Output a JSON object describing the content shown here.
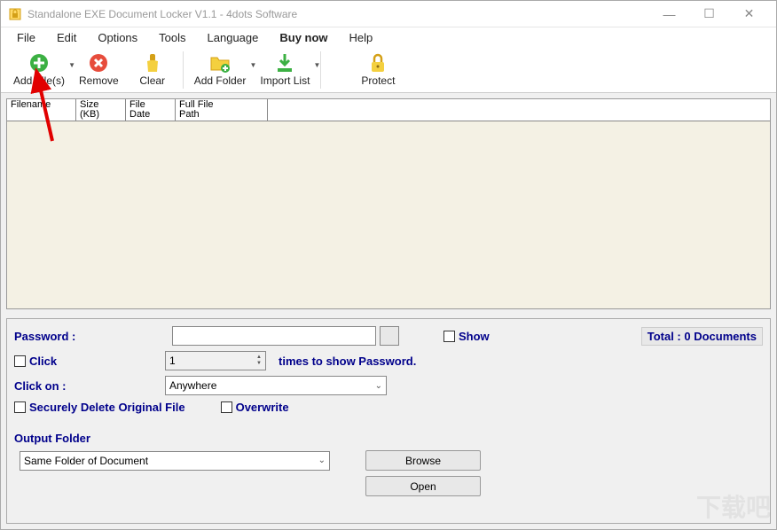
{
  "window": {
    "title": "Standalone EXE Document Locker V1.1 - 4dots Software"
  },
  "menu": {
    "file": "File",
    "edit": "Edit",
    "options": "Options",
    "tools": "Tools",
    "language": "Language",
    "buynow": "Buy now",
    "help": "Help"
  },
  "toolbar": {
    "add_files": "Add File(s)",
    "remove": "Remove",
    "clear": "Clear",
    "add_folder": "Add Folder",
    "import_list": "Import List",
    "protect": "Protect"
  },
  "columns": {
    "filename": "Filename",
    "size": "Size\n(KB)",
    "filedate": "File\nDate",
    "fullpath": "Full File\nPath"
  },
  "panel": {
    "password_label": "Password :",
    "show_label": "Show",
    "click_label": "Click",
    "click_times_value": "1",
    "times_text": "times to show Password.",
    "click_on_label": "Click on :",
    "click_on_value": "Anywhere",
    "secure_delete_label": "Securely Delete Original File",
    "overwrite_label": "Overwrite",
    "output_folder_label": "Output Folder",
    "output_folder_value": "Same Folder of Document",
    "browse_label": "Browse",
    "open_label": "Open",
    "total_label": "Total : 0 Documents"
  }
}
